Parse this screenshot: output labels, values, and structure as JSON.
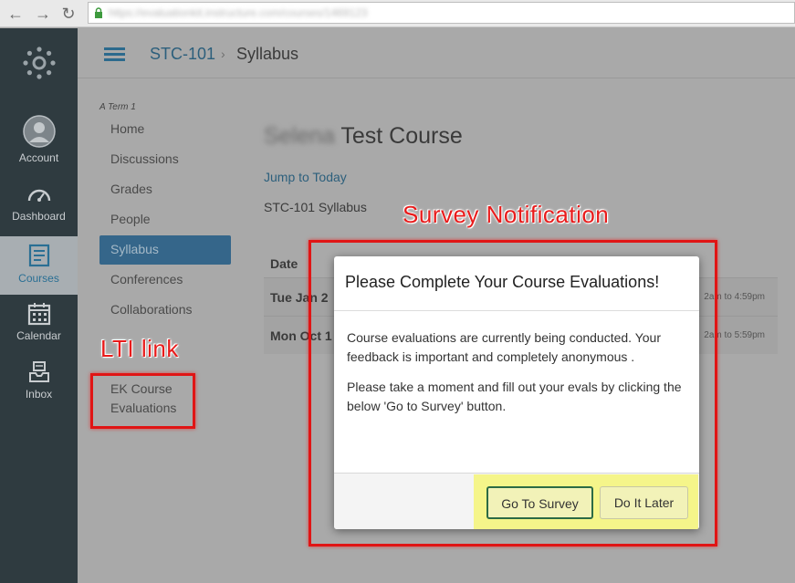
{
  "browser": {
    "back_glyph": "←",
    "forward_glyph": "→",
    "reload_glyph": "↻",
    "url": "https://evaluationkit.instructure.com/courses/1469123"
  },
  "global_nav": {
    "items": [
      {
        "label": "Account",
        "icon": "avatar-icon"
      },
      {
        "label": "Dashboard",
        "icon": "dashboard-icon"
      },
      {
        "label": "Courses",
        "icon": "courses-icon",
        "active": true
      },
      {
        "label": "Calendar",
        "icon": "calendar-icon"
      },
      {
        "label": "Inbox",
        "icon": "inbox-icon"
      }
    ]
  },
  "breadcrumb": {
    "course": "STC-101",
    "separator": "›",
    "current": "Syllabus"
  },
  "course_nav": {
    "term": "A Term 1",
    "items": [
      "Home",
      "Discussions",
      "Grades",
      "People",
      "Syllabus",
      "Conferences",
      "Collaborations"
    ],
    "active": "Syllabus",
    "lti_item_line1": "EK Course",
    "lti_item_line2": "Evaluations"
  },
  "main": {
    "title_blurred": "Selena",
    "title": "Test Course",
    "jump_link": "Jump to Today",
    "syllabus_label": "STC-101 Syllabus",
    "table_header": "Date",
    "rows": [
      {
        "date": "Tue Jan 2",
        "time": "2am to 4:59pm"
      },
      {
        "date": "Mon Oct 1",
        "time": "2am to 5:59pm"
      }
    ]
  },
  "annotations": {
    "survey": "Survey Notification",
    "lti": "LTI link",
    "color": "#e01515"
  },
  "modal": {
    "title": "Please Complete Your Course Evaluations!",
    "paragraph1": "Course evaluations are currently being conducted. Your feedback is important and completely anonymous .",
    "paragraph2": "Please take a moment and fill out your evals by clicking the below 'Go to Survey' button.",
    "primary_button": "Go To Survey",
    "secondary_button": "Do It Later",
    "highlight_color": "#f5f58a"
  }
}
